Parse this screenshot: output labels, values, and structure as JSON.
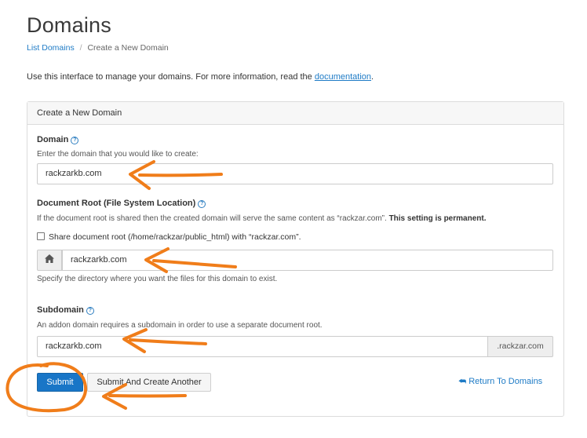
{
  "page": {
    "title": "Domains",
    "intro_text": "Use this interface to manage your domains. For more information, read the ",
    "intro_link": "documentation",
    "intro_end": "."
  },
  "breadcrumb": {
    "link": "List Domains",
    "separator": "/",
    "current": "Create a New Domain"
  },
  "panel": {
    "heading": "Create a New Domain"
  },
  "domain": {
    "label": "Domain",
    "help": "?",
    "hint": "Enter the domain that you would like to create:",
    "value": "rackzarkb.com"
  },
  "docroot": {
    "label": "Document Root (File System Location)",
    "help": "?",
    "hint_start": "If the document root is shared then the created domain will serve the same content as “rackzar.com”.",
    "hint_bold": "This setting is permanent.",
    "checkbox_label": "Share document root (/home/rackzar/public_html) with “rackzar.com”.",
    "value": "rackzarkb.com",
    "home_icon": "home-icon",
    "below_hint": "Specify the directory where you want the files for this domain to exist."
  },
  "subdomain": {
    "label": "Subdomain",
    "help": "?",
    "hint": "An addon domain requires a subdomain in order to use a separate document root.",
    "value": "rackzarkb.com",
    "suffix": ".rackzar.com"
  },
  "actions": {
    "submit": "Submit",
    "submit_another": "Submit And Create Another",
    "return": "Return To Domains",
    "return_icon": "reply-icon"
  },
  "colors": {
    "accent": "#1976c7",
    "link": "#1e7bc6",
    "annotation": "#f07d1a"
  }
}
